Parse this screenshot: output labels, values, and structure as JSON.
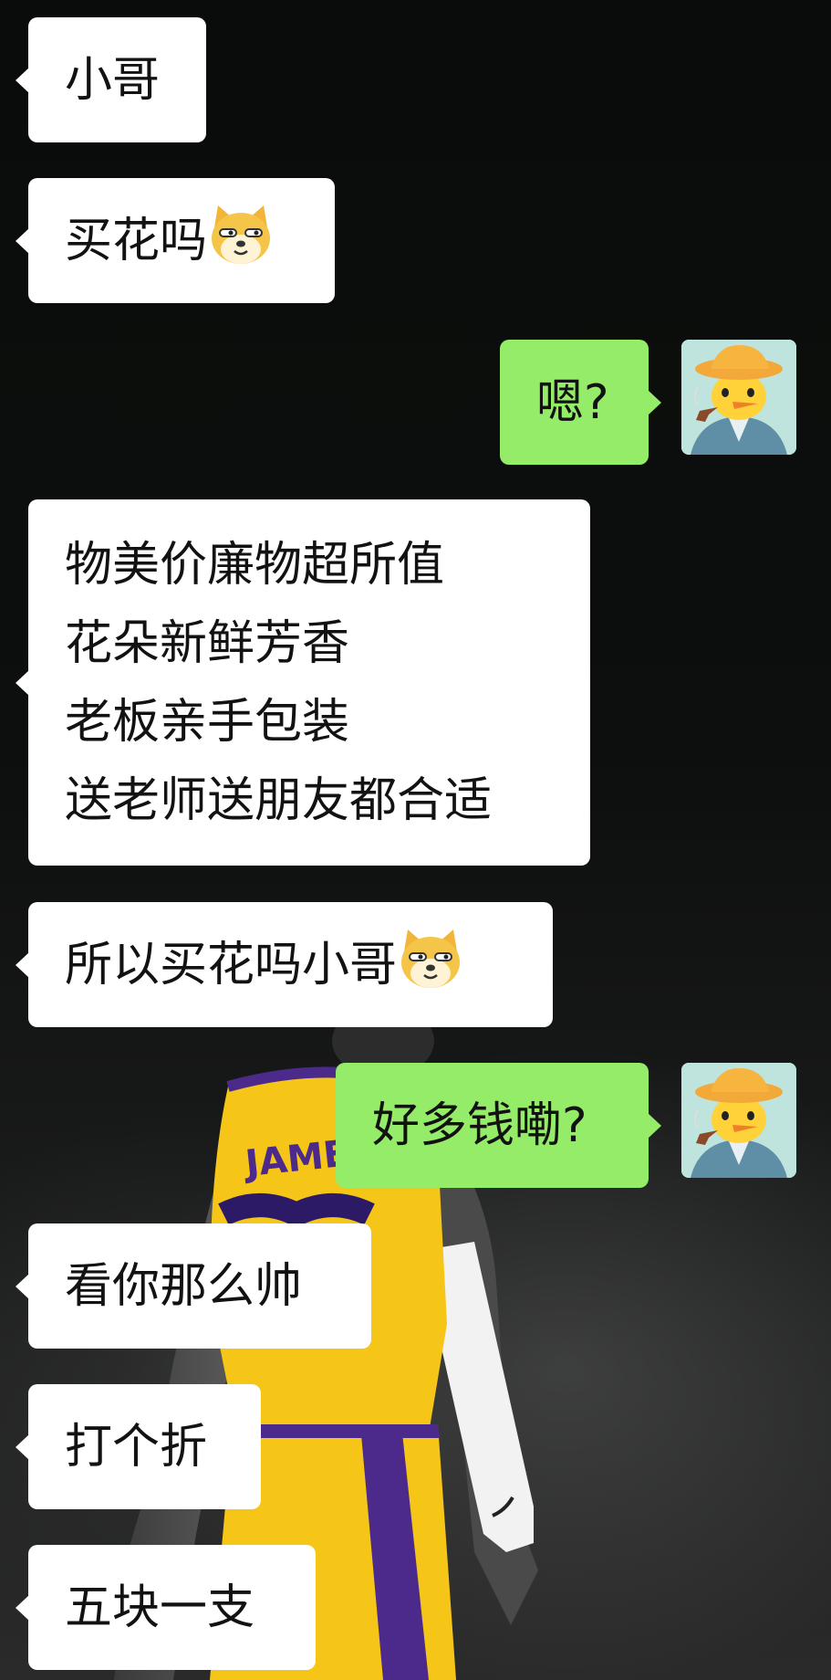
{
  "chat": {
    "messages": [
      {
        "side": "in",
        "lines": [
          "小哥"
        ]
      },
      {
        "side": "in",
        "lines": [
          "买花吗"
        ],
        "emoji": "doge-emoji"
      },
      {
        "side": "out",
        "lines": [
          "嗯?"
        ],
        "avatar": "duck-painter-avatar"
      },
      {
        "side": "in",
        "lines": [
          "物美价廉物超所值",
          "花朵新鲜芳香",
          "老板亲手包装",
          "送老师送朋友都合适"
        ]
      },
      {
        "side": "in",
        "lines": [
          "所以买花吗小哥"
        ],
        "emoji": "doge-emoji"
      },
      {
        "side": "out",
        "lines": [
          "好多钱嘞?"
        ],
        "avatar": "duck-painter-avatar"
      },
      {
        "side": "in",
        "lines": [
          "看你那么帅"
        ]
      },
      {
        "side": "in",
        "lines": [
          "打个折"
        ]
      },
      {
        "side": "in",
        "lines": [
          "五块一支"
        ]
      }
    ]
  },
  "background": {
    "jersey_text": "JAMES",
    "jersey_color": "#f5c518",
    "trim_color": "#4b2a8c"
  },
  "colors": {
    "incoming_bubble": "#ffffff",
    "outgoing_bubble": "#95ec69",
    "text": "#121212"
  }
}
